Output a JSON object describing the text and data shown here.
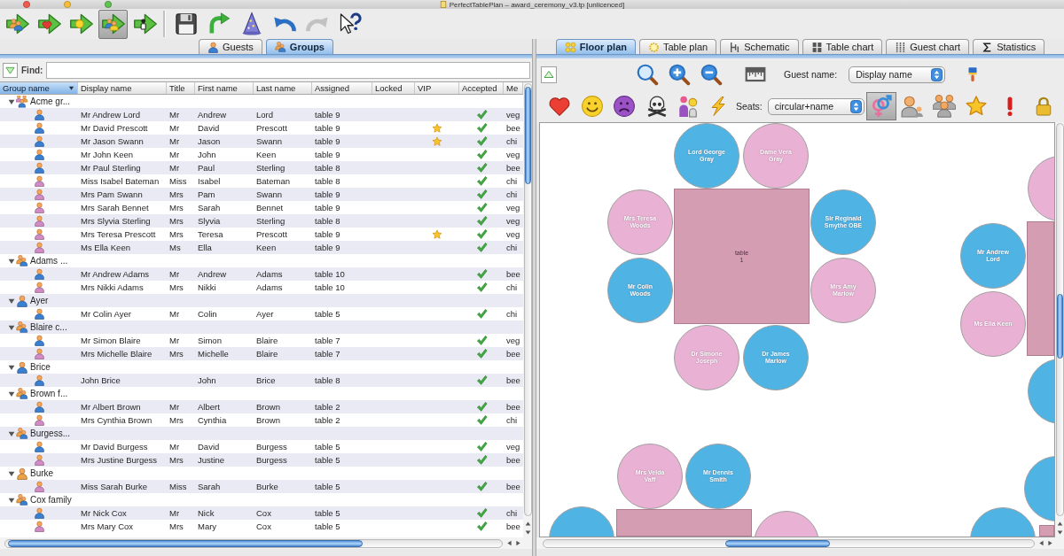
{
  "window": {
    "title": "PerfectTablePlan – award_ceremony_v3.tp [unlicenced]"
  },
  "toolbar": {
    "modes": [
      {
        "kind": "arrow-people",
        "selected": false
      },
      {
        "kind": "arrow-heart",
        "selected": false
      },
      {
        "kind": "arrow-sun",
        "selected": false
      },
      {
        "kind": "arrow-crowd",
        "selected": true
      },
      {
        "kind": "arrow-figure",
        "selected": false
      }
    ],
    "actions": [
      {
        "kind": "save",
        "disabled": false
      },
      {
        "kind": "refresh",
        "disabled": false
      },
      {
        "kind": "wizard",
        "disabled": false
      },
      {
        "kind": "undo",
        "disabled": false
      },
      {
        "kind": "redo",
        "disabled": true
      },
      {
        "kind": "help",
        "disabled": false
      }
    ]
  },
  "left_tabs": [
    {
      "label": "Guests",
      "kind": "person",
      "selected": false
    },
    {
      "label": "Groups",
      "kind": "people",
      "selected": true
    }
  ],
  "find": {
    "label": "Find:"
  },
  "table": {
    "columns": [
      {
        "label": "Group name",
        "sorted": true
      },
      {
        "label": "Display name",
        "sorted": false
      },
      {
        "label": "Title",
        "sorted": false
      },
      {
        "label": "First name",
        "sorted": false
      },
      {
        "label": "Last name",
        "sorted": false
      },
      {
        "label": "Assigned",
        "sorted": false
      },
      {
        "label": "Locked",
        "sorted": false
      },
      {
        "label": "VIP",
        "sorted": false
      },
      {
        "label": "Accepted",
        "sorted": false
      },
      {
        "label": "Me",
        "sorted": false
      }
    ],
    "groups": [
      {
        "name": "Acme gr...",
        "kind": "crowd",
        "expanded": true,
        "children": [
          {
            "kind": "male",
            "display_name": "Mr Andrew Lord",
            "title": "Mr",
            "first_name": "Andrew",
            "last_name": "Lord",
            "assigned": "table 9",
            "vip": false,
            "accepted": true,
            "column_10": "veg"
          },
          {
            "kind": "male",
            "display_name": "Mr David Prescott",
            "title": "Mr",
            "first_name": "David",
            "last_name": "Prescott",
            "assigned": "table 9",
            "vip": true,
            "accepted": true,
            "column_10": "bee"
          },
          {
            "kind": "male",
            "display_name": "Mr Jason Swann",
            "title": "Mr",
            "first_name": "Jason",
            "last_name": "Swann",
            "assigned": "table 9",
            "vip": true,
            "accepted": true,
            "column_10": "chi"
          },
          {
            "kind": "male",
            "display_name": "Mr John Keen",
            "title": "Mr",
            "first_name": "John",
            "last_name": "Keen",
            "assigned": "table 9",
            "vip": false,
            "accepted": true,
            "column_10": "veg"
          },
          {
            "kind": "male",
            "display_name": "Mr Paul Sterling",
            "title": "Mr",
            "first_name": "Paul",
            "last_name": "Sterling",
            "assigned": "table 8",
            "vip": false,
            "accepted": true,
            "column_10": "bee"
          },
          {
            "kind": "female",
            "display_name": "Miss Isabel Bateman",
            "title": "Miss",
            "first_name": "Isabel",
            "last_name": "Bateman",
            "assigned": "table 8",
            "vip": false,
            "accepted": true,
            "column_10": "chi"
          },
          {
            "kind": "female",
            "display_name": "Mrs Pam Swann",
            "title": "Mrs",
            "first_name": "Pam",
            "last_name": "Swann",
            "assigned": "table 9",
            "vip": false,
            "accepted": true,
            "column_10": "chi"
          },
          {
            "kind": "female",
            "display_name": "Mrs Sarah Bennet",
            "title": "Mrs",
            "first_name": "Sarah",
            "last_name": "Bennet",
            "assigned": "table 9",
            "vip": false,
            "accepted": true,
            "column_10": "veg"
          },
          {
            "kind": "female",
            "display_name": "Mrs Slyvia Sterling",
            "title": "Mrs",
            "first_name": "Slyvia",
            "last_name": "Sterling",
            "assigned": "table 8",
            "vip": false,
            "accepted": true,
            "column_10": "veg"
          },
          {
            "kind": "female",
            "display_name": "Mrs Teresa Prescott",
            "title": "Mrs",
            "first_name": "Teresa",
            "last_name": "Prescott",
            "assigned": "table 9",
            "vip": true,
            "accepted": true,
            "column_10": "veg"
          },
          {
            "kind": "female",
            "display_name": "Ms Ella Keen",
            "title": "Ms",
            "first_name": "Ella",
            "last_name": "Keen",
            "assigned": "table 9",
            "vip": false,
            "accepted": true,
            "column_10": "chi"
          }
        ]
      },
      {
        "name": "Adams ...",
        "kind": "couple",
        "expanded": true,
        "children": [
          {
            "kind": "male",
            "display_name": "Mr Andrew Adams",
            "title": "Mr",
            "first_name": "Andrew",
            "last_name": "Adams",
            "assigned": "table 10",
            "vip": false,
            "accepted": true,
            "column_10": "bee"
          },
          {
            "kind": "female",
            "display_name": "Mrs Nikki Adams",
            "title": "Mrs",
            "first_name": "Nikki",
            "last_name": "Adams",
            "assigned": "table 10",
            "vip": false,
            "accepted": true,
            "column_10": "chi"
          }
        ]
      },
      {
        "name": "Ayer",
        "kind": "man",
        "expanded": true,
        "children": [
          {
            "kind": "male",
            "display_name": "Mr Colin Ayer",
            "title": "Mr",
            "first_name": "Colin",
            "last_name": "Ayer",
            "assigned": "table 5",
            "vip": false,
            "accepted": true,
            "column_10": "chi"
          }
        ]
      },
      {
        "name": "Blaire c...",
        "kind": "couple",
        "expanded": true,
        "children": [
          {
            "kind": "male",
            "display_name": "Mr Simon Blaire",
            "title": "Mr",
            "first_name": "Simon",
            "last_name": "Blaire",
            "assigned": "table 7",
            "vip": false,
            "accepted": true,
            "column_10": "veg"
          },
          {
            "kind": "female",
            "display_name": "Mrs Michelle Blaire",
            "title": "Mrs",
            "first_name": "Michelle",
            "last_name": "Blaire",
            "assigned": "table 7",
            "vip": false,
            "accepted": true,
            "column_10": "bee"
          }
        ]
      },
      {
        "name": "Brice",
        "kind": "man",
        "expanded": true,
        "children": [
          {
            "kind": "male",
            "display_name": "John Brice",
            "first_name": "John",
            "last_name": "Brice",
            "assigned": "table 8",
            "vip": false,
            "accepted": true,
            "column_10": "bee"
          }
        ]
      },
      {
        "name": "Brown f...",
        "kind": "couple",
        "expanded": true,
        "children": [
          {
            "kind": "male",
            "display_name": "Mr Albert Brown",
            "title": "Mr",
            "first_name": "Albert",
            "last_name": "Brown",
            "assigned": "table 2",
            "vip": false,
            "accepted": true,
            "column_10": "bee"
          },
          {
            "kind": "female",
            "display_name": "Mrs Cynthia Brown",
            "title": "Mrs",
            "first_name": "Cynthia",
            "last_name": "Brown",
            "assigned": "table 2",
            "vip": false,
            "accepted": true,
            "column_10": "chi"
          }
        ]
      },
      {
        "name": "Burgess...",
        "kind": "couple",
        "expanded": true,
        "children": [
          {
            "kind": "male",
            "display_name": "Mr David Burgess",
            "title": "Mr",
            "first_name": "David",
            "last_name": "Burgess",
            "assigned": "table 5",
            "vip": false,
            "accepted": true,
            "column_10": "veg"
          },
          {
            "kind": "female",
            "display_name": "Mrs Justine Burgess",
            "title": "Mrs",
            "first_name": "Justine",
            "last_name": "Burgess",
            "assigned": "table 5",
            "vip": false,
            "accepted": true,
            "column_10": "bee"
          }
        ]
      },
      {
        "name": "Burke",
        "kind": "woman",
        "expanded": true,
        "children": [
          {
            "kind": "female",
            "display_name": "Miss Sarah Burke",
            "title": "Miss",
            "first_name": "Sarah",
            "last_name": "Burke",
            "assigned": "table 5",
            "vip": false,
            "accepted": true,
            "column_10": "bee"
          }
        ]
      },
      {
        "name": "Cox family",
        "kind": "couple",
        "expanded": true,
        "children": [
          {
            "kind": "male",
            "display_name": "Mr Nick Cox",
            "title": "Mr",
            "first_name": "Nick",
            "last_name": "Cox",
            "assigned": "table 5",
            "vip": false,
            "accepted": true,
            "column_10": "chi"
          },
          {
            "kind": "female",
            "display_name": "Mrs Mary Cox",
            "title": "Mrs",
            "first_name": "Mary",
            "last_name": "Cox",
            "assigned": "table 5",
            "vip": false,
            "accepted": true,
            "column_10": "bee"
          }
        ]
      }
    ]
  },
  "right_tabs": [
    {
      "label": "Floor plan",
      "kind": "dots",
      "selected": true
    },
    {
      "label": "Table plan",
      "kind": "sun",
      "selected": false
    },
    {
      "label": "Schematic",
      "kind": "bars",
      "selected": false
    },
    {
      "label": "Table chart",
      "kind": "grid",
      "selected": false
    },
    {
      "label": "Guest chart",
      "kind": "columns",
      "selected": false
    },
    {
      "label": "Statistics",
      "kind": "sigma",
      "selected": false
    }
  ],
  "plan_toolbar": {
    "rows": [
      {
        "items": [
          {
            "kind": "collapse"
          },
          {
            "kind": "zoom-fit"
          },
          {
            "kind": "zoom-in"
          },
          {
            "kind": "zoom-out"
          },
          {
            "kind": "ruler"
          },
          {
            "kind": "label",
            "text": "Guest name:"
          },
          {
            "kind": "dropdown",
            "value": "Display name"
          },
          {
            "kind": "paintbrush"
          }
        ]
      },
      {
        "items": [
          {
            "kind": "heart",
            "selected": false
          },
          {
            "kind": "smiley",
            "selected": false
          },
          {
            "kind": "sad",
            "selected": false
          },
          {
            "kind": "skull",
            "selected": false
          },
          {
            "kind": "figures",
            "selected": false
          },
          {
            "kind": "lightning",
            "selected": false
          },
          {
            "kind": "label",
            "text": "Seats:"
          },
          {
            "kind": "dropdown",
            "value": "circular+name"
          },
          {
            "kind": "gender",
            "selected": true
          },
          {
            "kind": "person",
            "selected": false
          },
          {
            "kind": "people",
            "selected": false
          },
          {
            "kind": "star",
            "selected": false
          },
          {
            "kind": "exclamation",
            "selected": false
          },
          {
            "kind": "lock",
            "selected": false
          }
        ]
      }
    ]
  },
  "floor_plan": {
    "tables": [
      {
        "label": "table 1",
        "seats": [
          {
            "name": "Lord George Gray",
            "color": "#4fb4e4"
          },
          {
            "name": "Dame Vera Gray",
            "color": "#e9b1d3"
          },
          {
            "name": "Mrs Teresa Woods",
            "color": "#e9b1d3"
          },
          {
            "name": "Sir Reginald Smythe OBE",
            "color": "#4fb4e4"
          },
          {
            "name": "Mr Colin Woods",
            "color": "#4fb4e4"
          },
          {
            "name": "Mrs Amy Marlow",
            "color": "#e9b1d3"
          },
          {
            "name": "Dr Simone Joseph",
            "color": "#e9b1d3"
          },
          {
            "name": "Dr James Marlow",
            "color": "#4fb4e4"
          }
        ]
      },
      {
        "seats": [
          {
            "color": "#e9b1d3"
          },
          {
            "name": "Mr Andrew Lord",
            "color": "#4fb4e4"
          },
          {
            "name": "Ms Ella Keen",
            "color": "#e9b1d3"
          },
          {
            "color": "#4fb4e4"
          }
        ]
      },
      {
        "seats": [
          {
            "name": "Mrs Velda Vaff",
            "color": "#e9b1d3"
          },
          {
            "name": "Mr Dennis Smith",
            "color": "#4fb4e4"
          },
          {
            "color": "#4fb4e4"
          },
          {
            "color": "#e9b1d3"
          }
        ]
      },
      {
        "seats": [
          {
            "color": "#4fb4e4"
          },
          {
            "color": "#4fb4e4"
          }
        ]
      }
    ]
  }
}
